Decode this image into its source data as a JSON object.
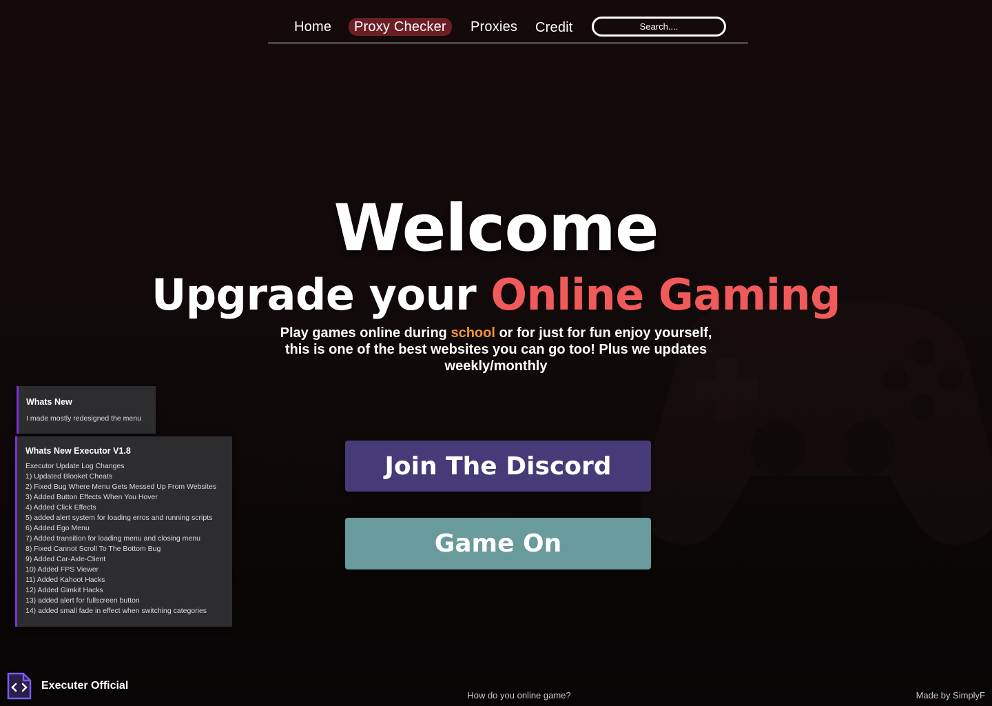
{
  "nav": {
    "links": [
      "Home",
      "Proxy Checker",
      "Proxies",
      "Credit"
    ],
    "active_link": "Proxy Checker",
    "search_placeholder": "Search...."
  },
  "hero": {
    "title": "Welcome",
    "subtitle_prefix": "Upgrade your ",
    "subtitle_accent": "Online Gaming",
    "desc_before": "Play games online during ",
    "desc_highlight": "school",
    "desc_after": " or for just for fun enjoy yourself, this is one of the best websites you can go too! Plus we updates weekly/monthly"
  },
  "buttons": {
    "discord_label": "Join The Discord",
    "game_label": "Game On"
  },
  "whats_new": {
    "title": "Whats New",
    "text": "I made mostly redesigned the menu"
  },
  "executor_log": {
    "title": "Whats New Executor V1.8",
    "lines": [
      "Executor Update Log Changes",
      "1) Updated Blooket Cheats",
      "2) Fixed Bug Where Menu Gets Messed Up From Websites",
      "3) Added Button Effects When You Hover",
      "4) Added Click Effects",
      "5) added alert system for loading erros and running scripts",
      "6) Added Ego Menu",
      "7) Added transition for loading menu and closing menu",
      "8) Fixed Cannot Scroll To The Bottom Bug",
      "9) Added Car-Axle-Client",
      "10) Added FPS Viewer",
      "11) Added Kahoot Hacks",
      "12) Added Gimkit Hacks",
      "13) added alert for fullscreen button",
      "14) added small fade in effect when switching categories"
    ]
  },
  "footer": {
    "brand_name": "Executer Official",
    "brand_icon": "code-file-icon",
    "question": "How do you online game?",
    "credit": "Made by SimplyF"
  },
  "colors": {
    "accent_red": "#f05a5b",
    "accent_orange": "#f2933c",
    "active_nav_bg": "#6b1e24",
    "discord_bg": "#463b78",
    "game_bg": "#6a9b9c",
    "panel_border": "#7b2fd8"
  }
}
